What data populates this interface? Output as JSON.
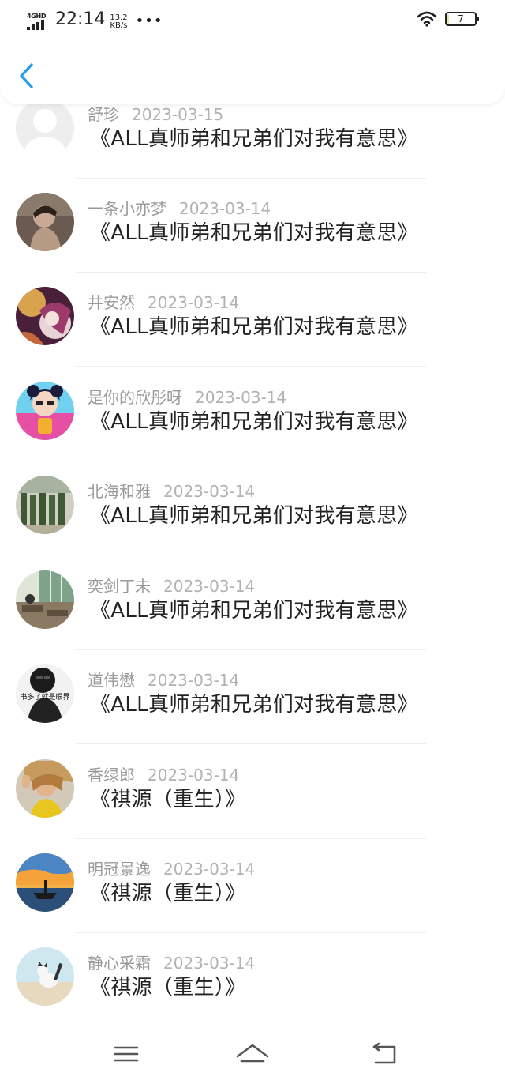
{
  "status_bar": {
    "network": "4GHD",
    "time": "22:14",
    "speed_value": "13.2",
    "speed_unit": "KB/s",
    "more": "•••",
    "battery_level": "7",
    "battery_fraction": 0.07
  },
  "header": {
    "back_icon": "chevron-left-icon",
    "accent_color": "#2b9bea"
  },
  "items": [
    {
      "name": "舒珍",
      "date": "2023-03-15",
      "title": "《ALL真师弟和兄弟们对我有意思》",
      "avatar": "default-avatar"
    },
    {
      "name": "一条小亦梦",
      "date": "2023-03-14",
      "title": "《ALL真师弟和兄弟们对我有意思》",
      "avatar": "girl-photo-avatar"
    },
    {
      "name": "井安然",
      "date": "2023-03-14",
      "title": "《ALL真师弟和兄弟们对我有意思》",
      "avatar": "anime-avatar"
    },
    {
      "name": "是你的欣彤呀",
      "date": "2023-03-14",
      "title": "《ALL真师弟和兄弟们对我有意思》",
      "avatar": "cartoon-girl-avatar"
    },
    {
      "name": "北海和雅",
      "date": "2023-03-14",
      "title": "《ALL真师弟和兄弟们对我有意思》",
      "avatar": "soldiers-avatar"
    },
    {
      "name": "奕剑丁未",
      "date": "2023-03-14",
      "title": "《ALL真师弟和兄弟们对我有意思》",
      "avatar": "classroom-avatar"
    },
    {
      "name": "道伟懋",
      "date": "2023-03-14",
      "title": "《ALL真师弟和兄弟们对我有意思》",
      "avatar": "bw-text-avatar",
      "avatar_text": "书多了就是眼界"
    },
    {
      "name": "香绿郎",
      "date": "2023-03-14",
      "title": "《祺源（重生）》",
      "avatar": "sunny-girl-avatar"
    },
    {
      "name": "明冠景逸",
      "date": "2023-03-14",
      "title": "《祺源（重生）》",
      "avatar": "sunset-boat-avatar"
    },
    {
      "name": "静心采霜",
      "date": "2023-03-14",
      "title": "《祺源（重生）》",
      "avatar": "cat-avatar"
    }
  ],
  "nav": {
    "menu_icon": "menu-icon",
    "home_icon": "home-icon",
    "back_icon": "back-icon"
  }
}
